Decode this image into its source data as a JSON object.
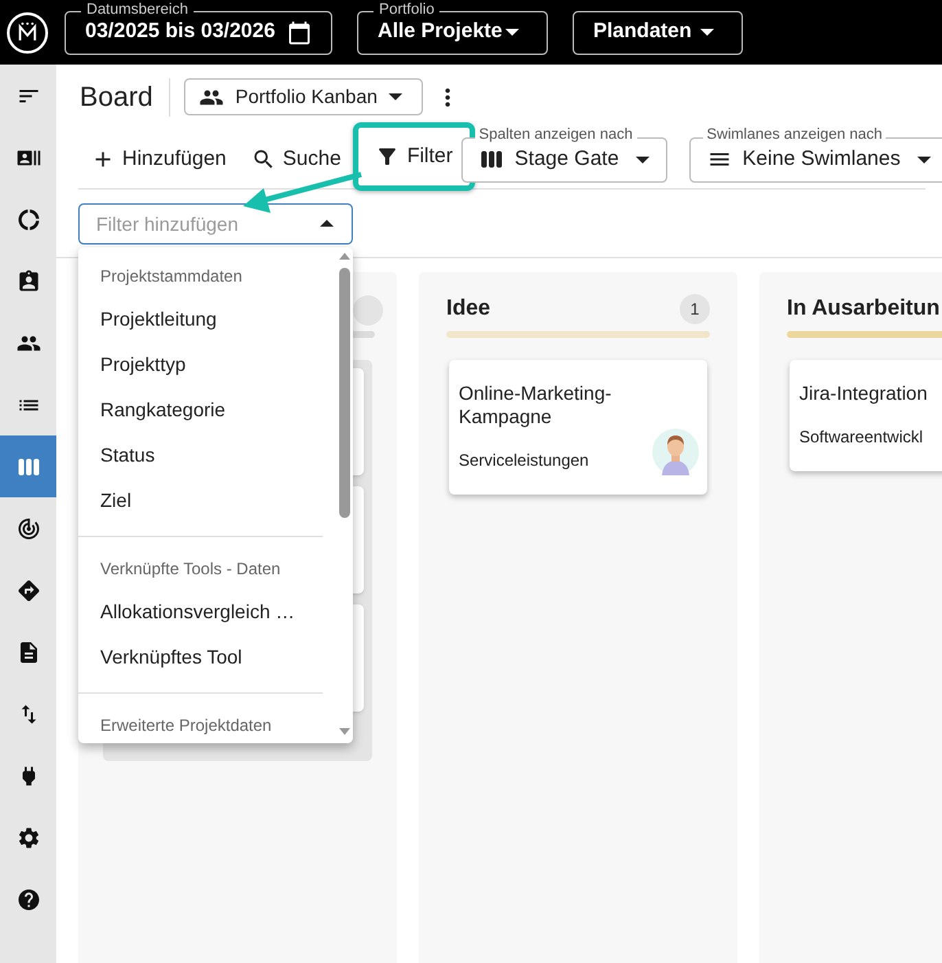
{
  "top_bar": {
    "fields": [
      {
        "label": "Datumsbereich",
        "value": "03/2025 bis 03/2026",
        "kind": "date"
      },
      {
        "label": "Portfolio",
        "value": "Alle Projekte",
        "kind": "select"
      },
      {
        "value": "Plandaten",
        "kind": "select"
      }
    ]
  },
  "sidebar": {
    "items": [
      {
        "selected": false
      },
      {
        "selected": false
      },
      {
        "selected": false
      },
      {
        "selected": false
      },
      {
        "selected": false
      },
      {
        "selected": false
      },
      {
        "selected": true
      },
      {
        "selected": false
      },
      {
        "selected": false
      },
      {
        "selected": false
      },
      {
        "selected": false
      },
      {
        "selected": false
      },
      {
        "selected": false
      },
      {
        "selected": false
      }
    ]
  },
  "header": {
    "title": "Board",
    "view": "Portfolio Kanban"
  },
  "toolbar": {
    "actions": [
      {
        "label": "Hinzufügen",
        "kind": "add",
        "highlighted": false
      },
      {
        "label": "Suche",
        "kind": "search",
        "highlighted": false
      },
      {
        "label": "Filter",
        "kind": "filter",
        "highlighted": true
      }
    ],
    "selects": [
      {
        "label": "Spalten anzeigen nach",
        "value": "Stage Gate",
        "kind": "columns"
      },
      {
        "label": "Swimlanes anzeigen nach",
        "value": "Keine Swimlanes",
        "kind": "rows"
      }
    ]
  },
  "filter_field": {
    "placeholder": "Filter hinzufügen",
    "expanded": true
  },
  "filter_menu": {
    "groups": [
      {
        "heading": "Projektstammdaten",
        "items": [
          "Projektleitung",
          "Projekttyp",
          "Rangkategorie",
          "Status",
          "Ziel"
        ]
      },
      {
        "heading": "Verknüpfte Tools - Daten",
        "items": [
          "Allokationsvergleich …",
          "Verknüpftes Tool"
        ]
      },
      {
        "heading": "Erweiterte Projektdaten"
      }
    ]
  },
  "columns": [
    {
      "title": "Idee",
      "count": "1",
      "color": "#f1e6c9",
      "cards": [
        {
          "title": "Online-Marketing-Kampagne",
          "subtitle": "Serviceleistungen",
          "avatar": true
        }
      ]
    },
    {
      "title": "In Ausarbeitun",
      "color": "#eed79c",
      "cards": [
        {
          "title": "Jira-Integration",
          "subtitle": "Softwareentwickl"
        }
      ]
    }
  ]
}
